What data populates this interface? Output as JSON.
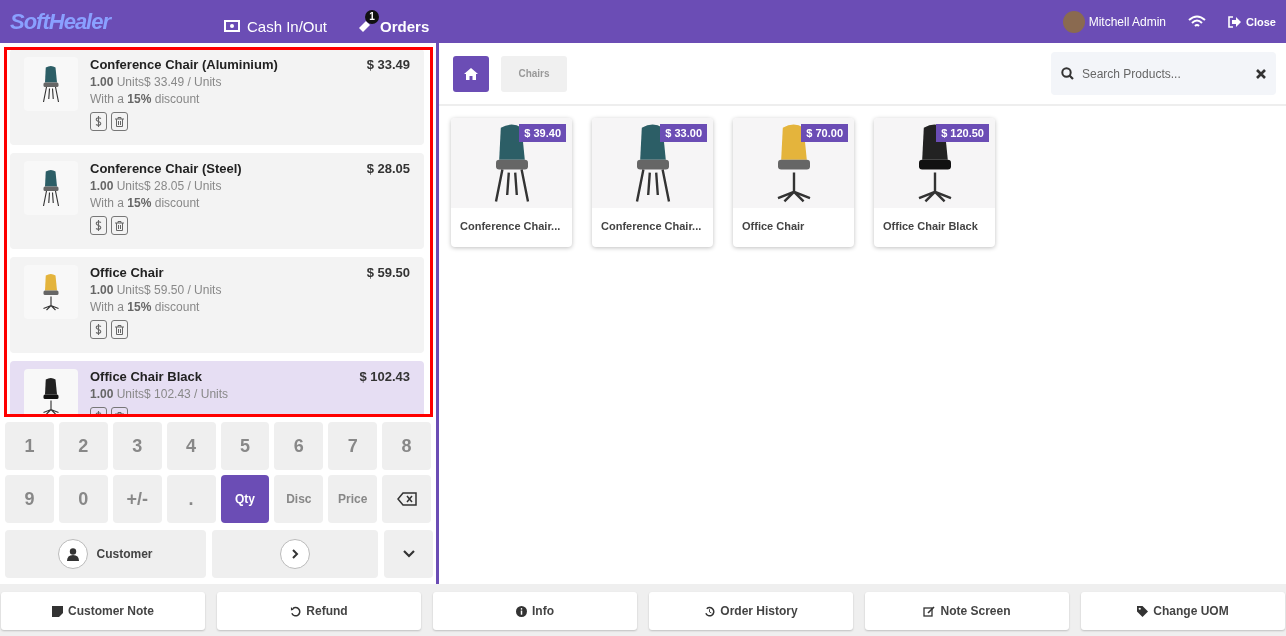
{
  "header": {
    "logo": "SoftHealer",
    "nav": [
      {
        "label": "Cash In/Out",
        "kind": "cash"
      },
      {
        "label": "Orders",
        "kind": "orders",
        "badge": "1"
      }
    ],
    "user": "Mitchell Admin",
    "close": "Close"
  },
  "order_lines": [
    {
      "name": "Conference Chair (Aluminium)",
      "price": "$ 33.49",
      "units": "**1.00** Units$ 33.49 / Units",
      "discount": "With a **15%** discount",
      "selected": false,
      "kind": "teal"
    },
    {
      "name": "Conference Chair (Steel)",
      "price": "$ 28.05",
      "units": "**1.00** Units$ 28.05 / Units",
      "discount": "With a **15%** discount",
      "selected": false,
      "kind": "teal"
    },
    {
      "name": "Office Chair",
      "price": "$ 59.50",
      "units": "**1.00** Units$ 59.50 / Units",
      "discount": "With a **15%** discount",
      "selected": false,
      "kind": "yellow"
    },
    {
      "name": "Office Chair Black",
      "price": "$ 102.43",
      "units": "**1.00** Units$ 102.43 / Units",
      "selected": true,
      "kind": "black"
    }
  ],
  "numpad": [
    {
      "label": "1",
      "kind": "key",
      "selected": false
    },
    {
      "label": "2",
      "kind": "key",
      "selected": false
    },
    {
      "label": "3",
      "kind": "key",
      "selected": false
    },
    {
      "label": "4",
      "kind": "key",
      "selected": false
    },
    {
      "label": "5",
      "kind": "key",
      "selected": false
    },
    {
      "label": "6",
      "kind": "key",
      "selected": false
    },
    {
      "label": "7",
      "kind": "key",
      "selected": false
    },
    {
      "label": "8",
      "kind": "key",
      "selected": false
    },
    {
      "label": "9",
      "kind": "key",
      "selected": false
    },
    {
      "label": "0",
      "kind": "key",
      "selected": false
    },
    {
      "label": "+/-",
      "kind": "key",
      "selected": false
    },
    {
      "label": ".",
      "kind": "key",
      "selected": false
    },
    {
      "label": "Qty",
      "kind": "mode",
      "selected": true
    },
    {
      "label": "Disc",
      "kind": "mode",
      "selected": false
    },
    {
      "label": "Price",
      "kind": "mode",
      "selected": false
    },
    {
      "kind": "backspace",
      "selected": false
    }
  ],
  "customer_button": "Customer",
  "breadcrumb": "Chairs",
  "search": {
    "placeholder": "Search Products..."
  },
  "products": [
    {
      "name": "Conference Chair...",
      "price": "$ 39.40",
      "kind": "teal"
    },
    {
      "name": "Conference Chair...",
      "price": "$ 33.00",
      "kind": "teal"
    },
    {
      "name": "Office Chair",
      "price": "$ 70.00",
      "kind": "yellow"
    },
    {
      "name": "Office Chair Black",
      "price": "$ 120.50",
      "kind": "black"
    }
  ],
  "footer_buttons": [
    {
      "label": "Customer Note",
      "kind": "note"
    },
    {
      "label": "Refund",
      "kind": "undo"
    },
    {
      "label": "Info",
      "kind": "info"
    },
    {
      "label": "Order History",
      "kind": "history"
    },
    {
      "label": "Note Screen",
      "kind": "edit"
    },
    {
      "label": "Change UOM",
      "kind": "tag"
    }
  ]
}
